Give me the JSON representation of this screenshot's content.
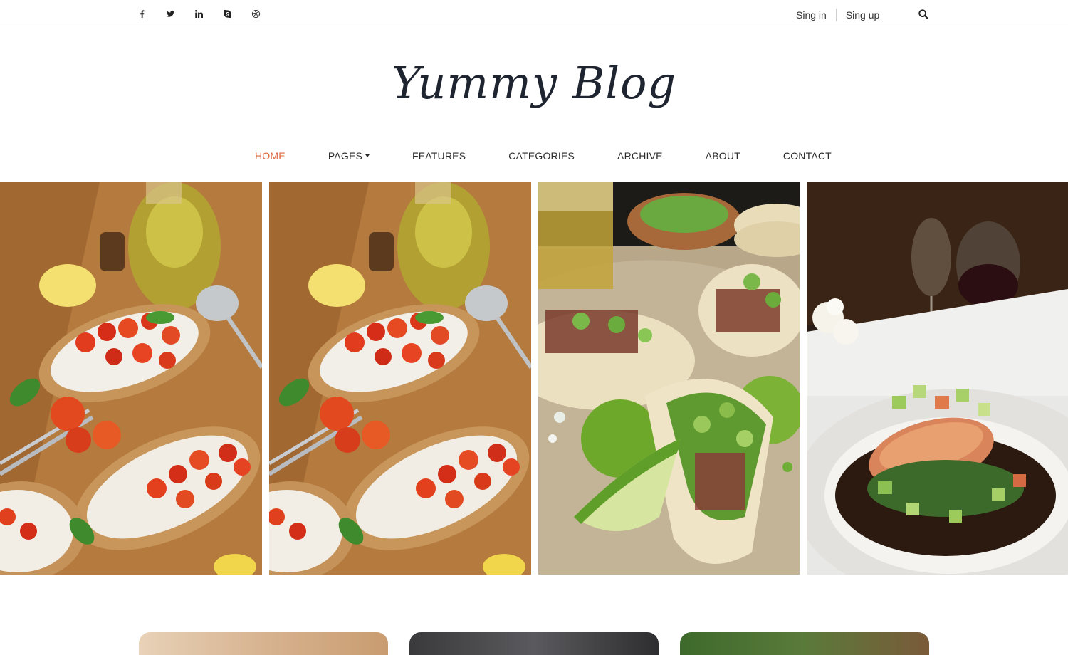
{
  "topbar": {
    "social": [
      {
        "name": "facebook-icon",
        "glyph": "f"
      },
      {
        "name": "twitter-icon",
        "glyph": "t"
      },
      {
        "name": "linkedin-icon",
        "glyph": "in"
      },
      {
        "name": "skype-icon",
        "glyph": "S"
      },
      {
        "name": "dribbble-icon",
        "glyph": "d"
      }
    ],
    "sign_in": "Sing in",
    "sign_up": "Sing up",
    "search_icon": "search-icon"
  },
  "logo": {
    "text": "Yummy Blog"
  },
  "nav": {
    "items": [
      {
        "label": "HOME",
        "active": true
      },
      {
        "label": "PAGES",
        "dropdown": true
      },
      {
        "label": "FEATURES"
      },
      {
        "label": "CATEGORIES"
      },
      {
        "label": "ARCHIVE"
      },
      {
        "label": "ABOUT"
      },
      {
        "label": "CONTACT"
      }
    ]
  },
  "hero": {
    "images": [
      {
        "name": "bruschetta-photo"
      },
      {
        "name": "bruschetta-photo"
      },
      {
        "name": "tacos-photo"
      },
      {
        "name": "salmon-dish-photo"
      }
    ]
  },
  "colors": {
    "accent": "#e0663a",
    "text": "#2a2a2a",
    "logo": "#1f2530"
  }
}
